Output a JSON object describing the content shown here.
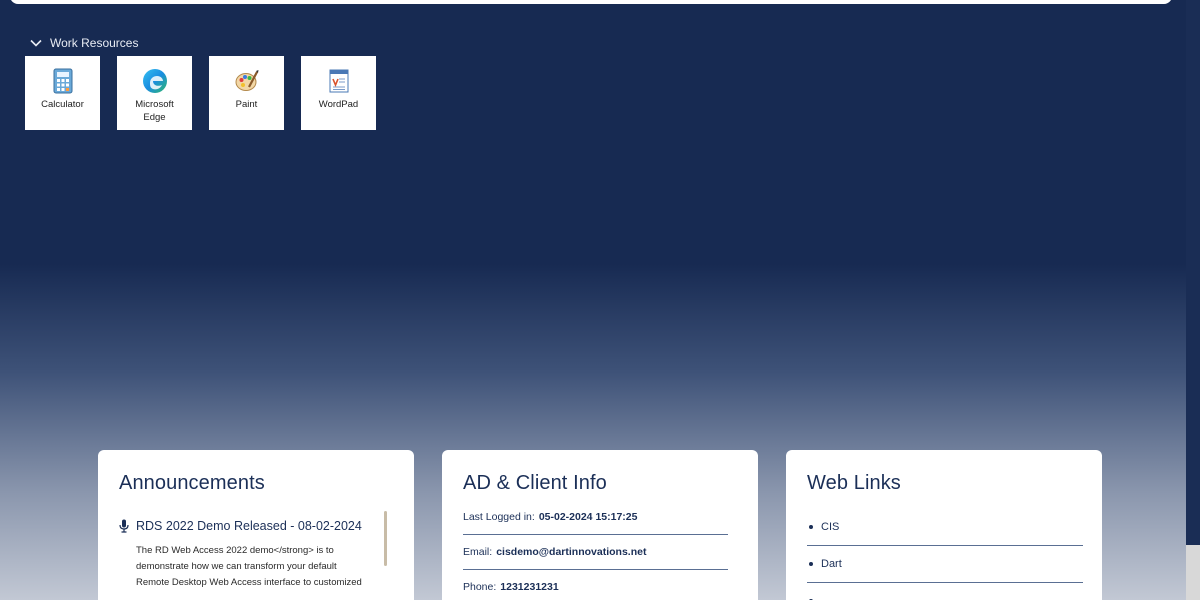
{
  "section": {
    "title": "Work Resources"
  },
  "apps": [
    {
      "label": "Calculator",
      "icon": "calculator-icon"
    },
    {
      "label": "Microsoft Edge",
      "icon": "edge-icon"
    },
    {
      "label": "Paint",
      "icon": "paint-icon"
    },
    {
      "label": "WordPad",
      "icon": "wordpad-icon"
    }
  ],
  "announcements": {
    "title": "Announcements",
    "items": [
      {
        "title": "RDS 2022 Demo Released - 08-02-2024",
        "body": "The RD Web Access 2022 demo</strong> is to demonstrate how we can transform your default Remote Desktop Web Access interface to customized"
      }
    ]
  },
  "client_info": {
    "title": "AD & Client Info",
    "rows": [
      {
        "label": "Last Logged in:",
        "value": "05-02-2024 15:17:25"
      },
      {
        "label": "Email:",
        "value": "cisdemo@dartinnovations.net"
      },
      {
        "label": "Phone:",
        "value": "1231231231"
      }
    ]
  },
  "web_links": {
    "title": "Web Links",
    "items": [
      "CIS",
      "Dart",
      ""
    ]
  },
  "colors": {
    "background_top": "#172a52",
    "accent_text": "#1b2f57"
  }
}
